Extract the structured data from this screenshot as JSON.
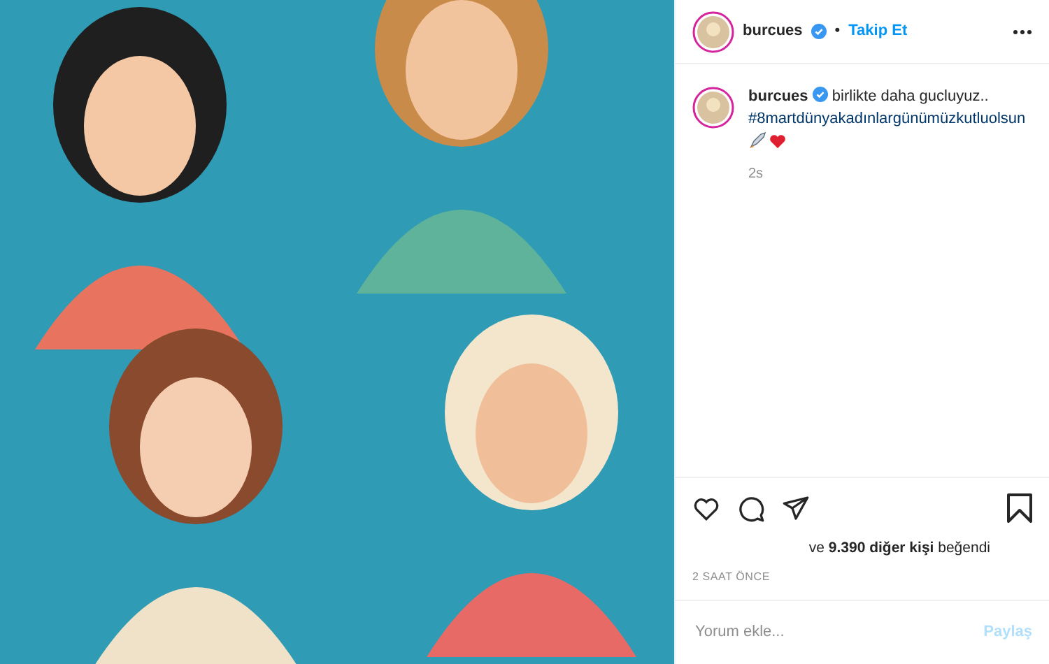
{
  "header": {
    "username": "burcues",
    "verified": true,
    "separator": "•",
    "follow": "Takip Et"
  },
  "caption": {
    "username": "burcues",
    "verified": true,
    "text": "birlikte daha gucluyuz..",
    "hashtag": "#8martdünyakadınlargünümüzkutluolsun",
    "time": "2s"
  },
  "actions": {
    "liked": false,
    "saved": false
  },
  "likes": "ve **9.390 diğer kişi** beğendi",
  "timestamp": "2 SAAT ÖNCE",
  "comment": {
    "placeholder": "Yorum ekle...",
    "submit": "Paylaş",
    "disabled": true
  }
}
